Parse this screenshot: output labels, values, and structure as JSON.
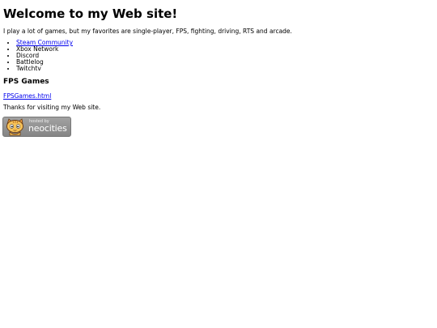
{
  "page": {
    "title": "Welcome to my Web site!",
    "intro": "I play a lot of games, but my favorites are single-player, FPS, fighting, driving, RTS and arcade.",
    "links": [
      {
        "label": "Steam Community",
        "is_link": true
      },
      {
        "label": "Xbox Network",
        "is_link": false
      },
      {
        "label": "Discord",
        "is_link": false
      },
      {
        "label": "Battlelog",
        "is_link": false
      },
      {
        "label": "Twitchtv",
        "is_link": false
      }
    ],
    "section_heading": "FPS Games",
    "fps_link": "FPSGames.html",
    "thanks": "Thanks for visiting my Web site."
  },
  "badge": {
    "small_text": "hosted by",
    "brand_text": "neocities",
    "icon": "neocities-cat-icon"
  },
  "colors": {
    "link": "#0000ee",
    "text": "#000000",
    "badge_bg": "#939393"
  }
}
